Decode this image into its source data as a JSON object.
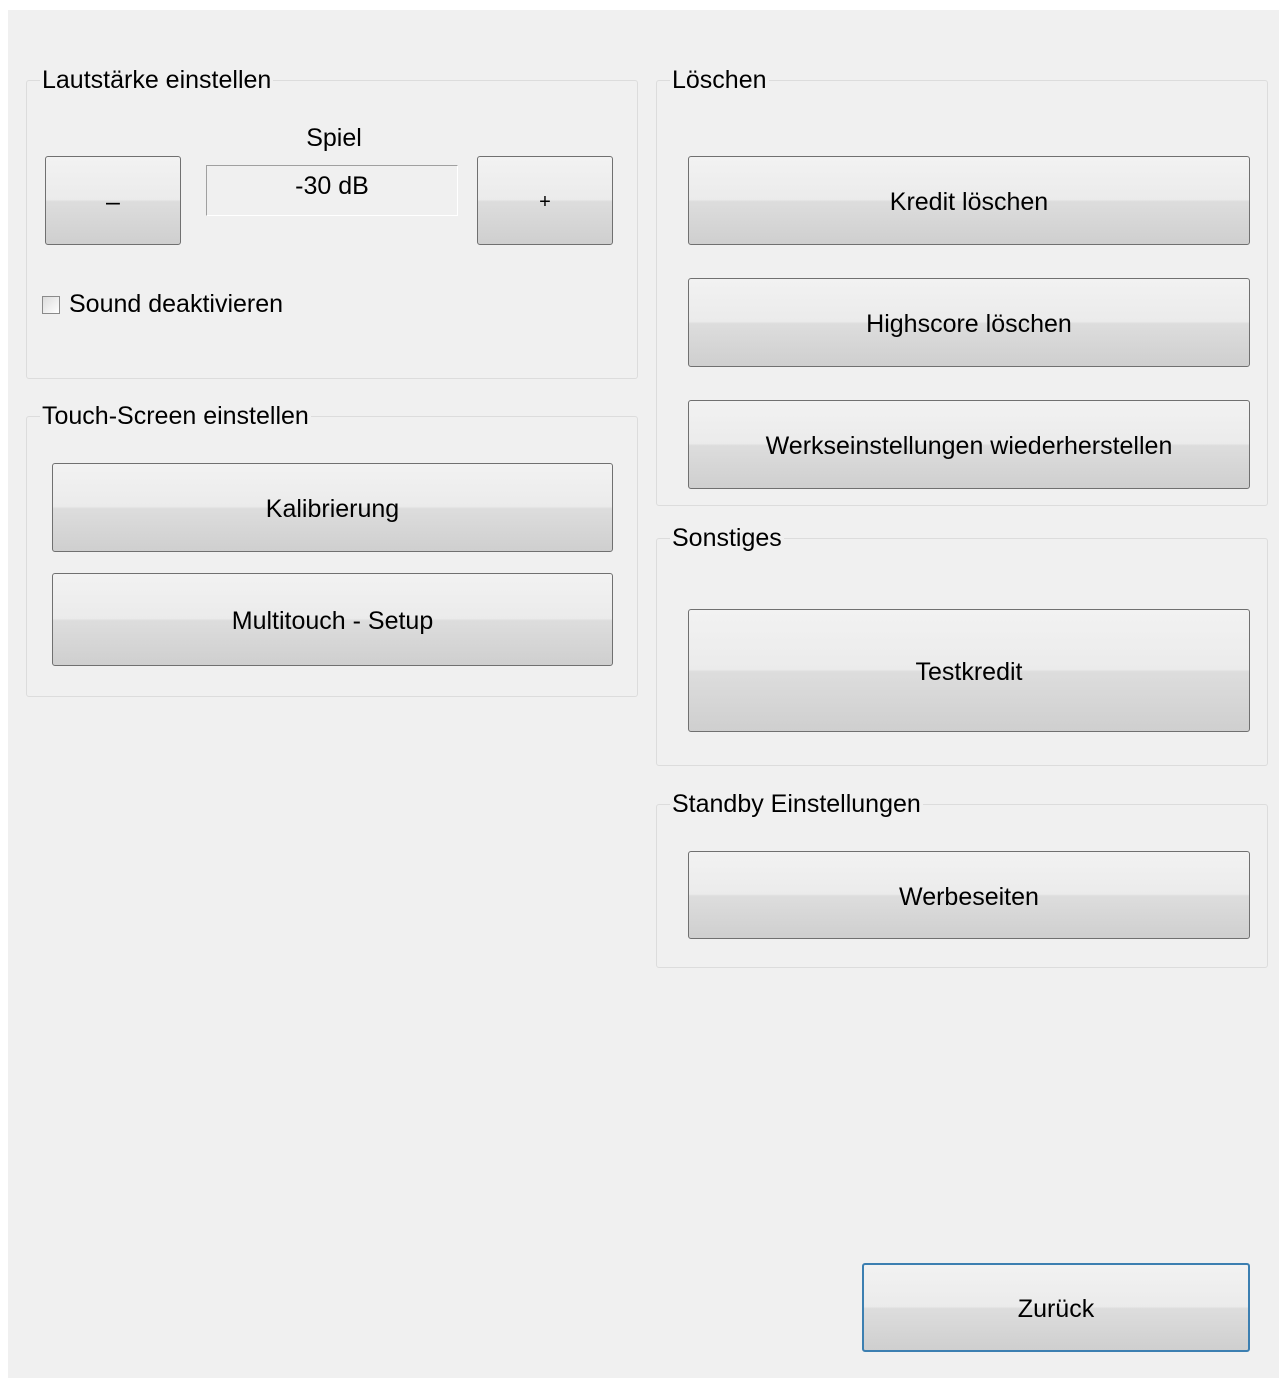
{
  "volume": {
    "title": "Lautstärke einstellen",
    "channel_label": "Spiel",
    "value": "-30 dB",
    "minus_label": "–",
    "plus_label": "+",
    "mute_label": "Sound deaktivieren",
    "mute_checked": false
  },
  "touch": {
    "title": "Touch-Screen einstellen",
    "calibrate_label": "Kalibrierung",
    "multitouch_label": "Multitouch - Setup"
  },
  "delete": {
    "title": "Löschen",
    "credit_label": "Kredit löschen",
    "highscore_label": "Highscore löschen",
    "factory_label": "Werkseinstellungen wiederherstellen"
  },
  "misc": {
    "title": "Sonstiges",
    "testcredit_label": "Testkredit"
  },
  "standby": {
    "title": "Standby Einstellungen",
    "ads_label": "Werbeseiten"
  },
  "footer": {
    "back_label": "Zurück"
  }
}
